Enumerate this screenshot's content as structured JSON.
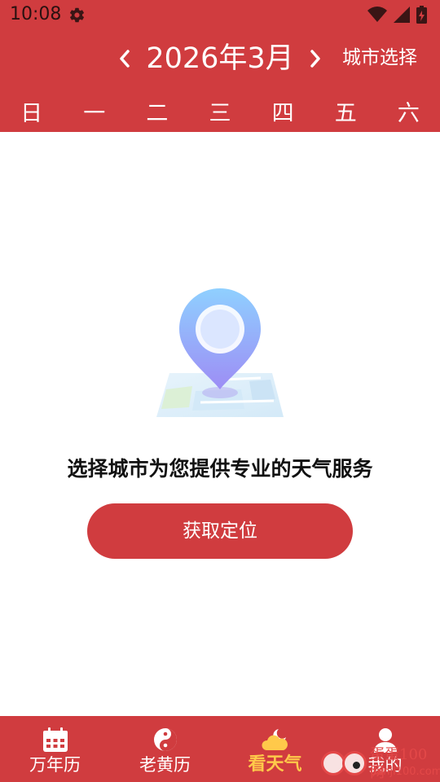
{
  "status_bar": {
    "time": "10:08",
    "icons": [
      "gear-icon",
      "wifi-icon",
      "signal-icon",
      "battery-icon"
    ]
  },
  "header": {
    "month_title": "2026年3月",
    "prev_icon": "chevron-left-icon",
    "next_icon": "chevron-right-icon",
    "city_select_label": "城市选择",
    "weekdays": [
      "日",
      "一",
      "二",
      "三",
      "四",
      "五",
      "六"
    ]
  },
  "empty_state": {
    "illustration": "map-pin-illustration",
    "message": "选择城市为您提供专业的天气服务",
    "button_label": "获取定位"
  },
  "tabbar": {
    "tabs": [
      {
        "label": "万年历",
        "icon": "calendar-icon",
        "active": false
      },
      {
        "label": "老黄历",
        "icon": "yin-yang-icon",
        "active": false
      },
      {
        "label": "看天气",
        "icon": "weather-icon",
        "active": true
      },
      {
        "label": "我的",
        "icon": "user-icon",
        "active": false
      }
    ]
  },
  "watermark": {
    "text_top": "蛋蛋100网",
    "text_bottom": "danji100.com"
  },
  "colors": {
    "primary": "#d03c3f",
    "active_tab": "#ffc94a",
    "text_dark": "#111111",
    "background": "#ffffff"
  }
}
